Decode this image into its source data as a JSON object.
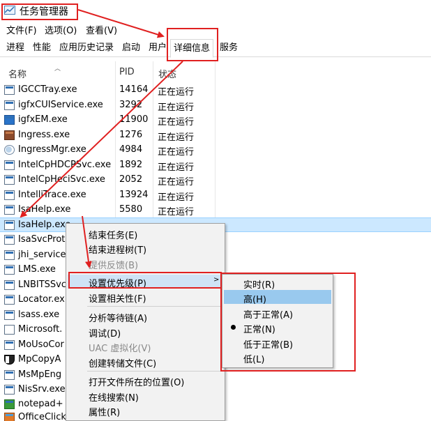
{
  "window": {
    "title": "任务管理器"
  },
  "menubar": {
    "items": [
      "文件(F)",
      "选项(O)",
      "查看(V)"
    ]
  },
  "tabs": [
    "进程",
    "性能",
    "应用历史记录",
    "启动",
    "用户",
    "详细信息",
    "服务"
  ],
  "active_tab": "详细信息",
  "columns": {
    "name": "名称",
    "pid": "PID",
    "status": "状态"
  },
  "rows": [
    {
      "name": "IGCCTray.exe",
      "pid": "14164",
      "status": "正在运行",
      "icon": "app-icon"
    },
    {
      "name": "igfxCUIService.exe",
      "pid": "3292",
      "status": "正在运行",
      "icon": "app-icon"
    },
    {
      "name": "igfxEM.exe",
      "pid": "11900",
      "status": "正在运行",
      "icon": "intel-graphics-icon"
    },
    {
      "name": "Ingress.exe",
      "pid": "1276",
      "status": "正在运行",
      "icon": "database-icon"
    },
    {
      "name": "IngressMgr.exe",
      "pid": "4984",
      "status": "正在运行",
      "icon": "magnifier-icon"
    },
    {
      "name": "IntelCpHDCPSvc.exe",
      "pid": "1892",
      "status": "正在运行",
      "icon": "app-icon"
    },
    {
      "name": "IntelCpHeciSvc.exe",
      "pid": "2052",
      "status": "正在运行",
      "icon": "app-icon"
    },
    {
      "name": "IntelliTrace.exe",
      "pid": "13924",
      "status": "正在运行",
      "icon": "app-icon"
    },
    {
      "name": "IsaHelp.exe",
      "pid": "5580",
      "status": "正在运行",
      "icon": "app-icon"
    },
    {
      "name": "IsaHelp.exe",
      "pid": "",
      "status": "",
      "icon": "app-icon"
    },
    {
      "name": "IsaSvcProt",
      "pid": "",
      "status": "",
      "icon": "app-icon"
    },
    {
      "name": "jhi_service",
      "pid": "",
      "status": "",
      "icon": "app-icon"
    },
    {
      "name": "LMS.exe",
      "pid": "",
      "status": "",
      "icon": "app-icon"
    },
    {
      "name": "LNBITSSvc",
      "pid": "",
      "status": "",
      "icon": "app-icon"
    },
    {
      "name": "Locator.ex",
      "pid": "",
      "status": "",
      "icon": "app-icon"
    },
    {
      "name": "lsass.exe",
      "pid": "",
      "status": "",
      "icon": "app-icon"
    },
    {
      "name": "Microsoft.",
      "pid": "",
      "status": "",
      "icon": "document-icon"
    },
    {
      "name": "MoUsoCor",
      "pid": "",
      "status": "",
      "icon": "app-icon"
    },
    {
      "name": "MpCopyA",
      "pid": "",
      "status": "",
      "icon": "shield-icon"
    },
    {
      "name": "MsMpEng",
      "pid": "",
      "status": "",
      "icon": "app-icon"
    },
    {
      "name": "NisSrv.exe",
      "pid": "",
      "status": "",
      "icon": "app-icon"
    },
    {
      "name": "notepad+",
      "pid": "",
      "status": "",
      "icon": "notepad-plus-icon"
    },
    {
      "name": "OfficeClick",
      "pid": "",
      "status": "",
      "icon": "office-icon"
    }
  ],
  "context_menu": {
    "items": [
      "结束任务(E)",
      "结束进程树(T)",
      "提供反馈(B)",
      "设置优先级(P)",
      "设置相关性(F)",
      "分析等待链(A)",
      "调试(D)",
      "UAC 虚拟化(V)",
      "创建转储文件(C)",
      "打开文件所在的位置(O)",
      "在线搜索(N)",
      "属性(R)"
    ],
    "disabled": [
      "提供反馈(B)",
      "UAC 虚拟化(V)"
    ],
    "highlighted": "设置优先级(P)"
  },
  "priority_submenu": {
    "items": [
      "实时(R)",
      "高(H)",
      "高于正常(A)",
      "正常(N)",
      "低于正常(B)",
      "低(L)"
    ],
    "highlighted": "高(H)",
    "checked": "正常(N)"
  },
  "colors": {
    "annotation": "#e02020",
    "selection": "#cce8ff",
    "highlight": "#99c9ee"
  }
}
